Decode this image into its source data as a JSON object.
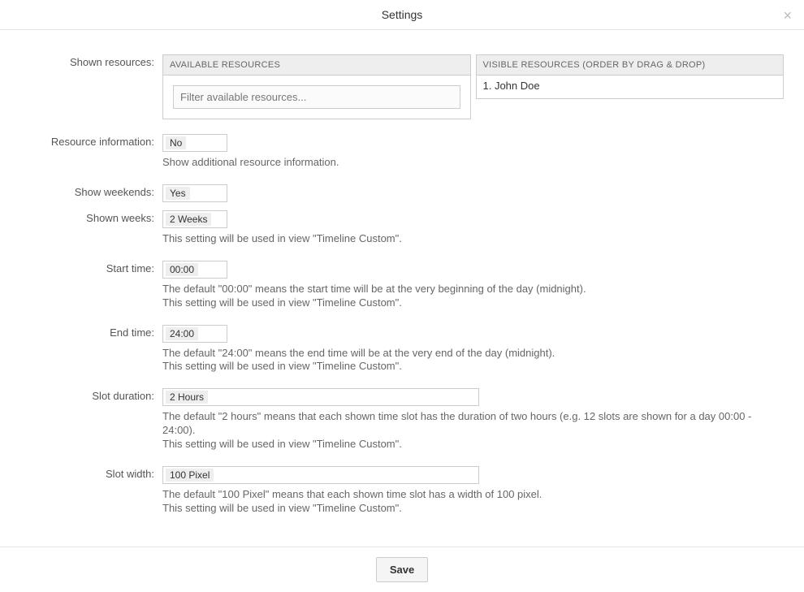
{
  "header": {
    "title": "Settings",
    "close_icon": "×"
  },
  "labels": {
    "shown_resources": "Shown resources:",
    "resource_information": "Resource information:",
    "show_weekends": "Show weekends:",
    "shown_weeks": "Shown weeks:",
    "start_time": "Start time:",
    "end_time": "End time:",
    "slot_duration": "Slot duration:",
    "slot_width": "Slot width:"
  },
  "resources": {
    "available_header": "AVAILABLE RESOURCES",
    "visible_header": "VISIBLE RESOURCES (ORDER BY DRAG & DROP)",
    "filter_placeholder": "Filter available resources...",
    "visible_items": [
      "1. John Doe"
    ]
  },
  "fields": {
    "resource_information": {
      "value": "No",
      "help": "Show additional resource information."
    },
    "show_weekends": {
      "value": "Yes"
    },
    "shown_weeks": {
      "value": "2 Weeks",
      "help": "This setting will be used in view \"Timeline Custom\"."
    },
    "start_time": {
      "value": "00:00",
      "help1": "The default \"00:00\" means the start time will be at the very beginning of the day (midnight).",
      "help2": "This setting will be used in view \"Timeline Custom\"."
    },
    "end_time": {
      "value": "24:00",
      "help1": "The default \"24:00\" means the end time will be at the very end of the day (midnight).",
      "help2": "This setting will be used in view \"Timeline Custom\"."
    },
    "slot_duration": {
      "value": "2 Hours",
      "help1": "The default \"2 hours\" means that each shown time slot has the duration of two hours (e.g. 12 slots are shown for a day 00:00 - 24:00).",
      "help2": "This setting will be used in view \"Timeline Custom\"."
    },
    "slot_width": {
      "value": "100 Pixel",
      "help1": "The default \"100 Pixel\" means that each shown time slot has a width of 100 pixel.",
      "help2": "This setting will be used in view \"Timeline Custom\"."
    }
  },
  "footer": {
    "save_label": "Save"
  }
}
